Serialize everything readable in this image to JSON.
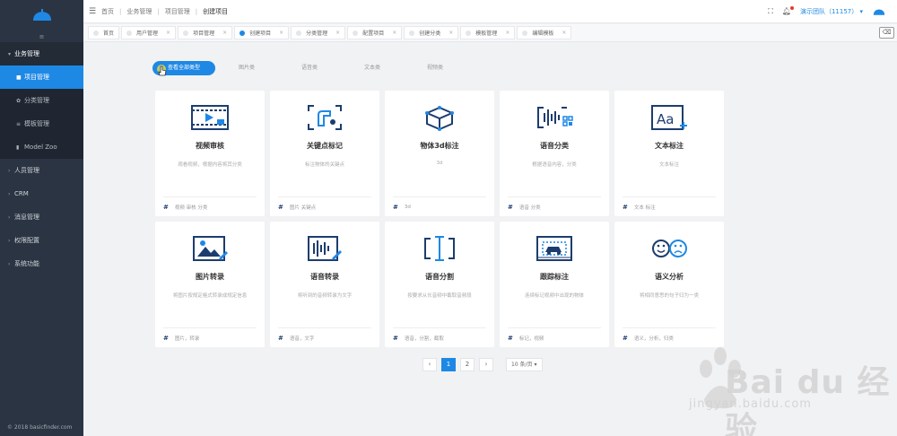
{
  "sidebar": {
    "collapse_icon": "≡",
    "groups": [
      {
        "label": "业务管理",
        "open": true
      },
      {
        "label": "人员管理"
      },
      {
        "label": "CRM"
      },
      {
        "label": "消息管理"
      },
      {
        "label": "权限配置"
      },
      {
        "label": "系统功能"
      }
    ],
    "sub_items": [
      {
        "label": "项目管理",
        "active": true
      },
      {
        "label": "分类管理"
      },
      {
        "label": "模板管理"
      },
      {
        "label": "Model Zoo"
      }
    ],
    "copyright": "© 2018 basicfinder.com"
  },
  "header": {
    "breadcrumbs": [
      "首页",
      "业务管理",
      "项目管理",
      "创建项目"
    ],
    "team": "演示团队（11157）"
  },
  "tabs": [
    {
      "label": "首页"
    },
    {
      "label": "用户管理"
    },
    {
      "label": "项目管理"
    },
    {
      "label": "创建项目",
      "active": true
    },
    {
      "label": "分类管理"
    },
    {
      "label": "配置项目"
    },
    {
      "label": "创建分类"
    },
    {
      "label": "模板管理"
    },
    {
      "label": "编辑模板"
    }
  ],
  "filters": [
    "查看全部类型",
    "图片类",
    "语音类",
    "文本类",
    "视频类"
  ],
  "cards": [
    {
      "title": "视频审核",
      "desc": "观看视频，根据内容将其分类",
      "tags": "视频 审核 分类",
      "icon": "video-review-icon"
    },
    {
      "title": "关键点标记",
      "desc": "标注物体的关键点",
      "tags": "图片 关键点",
      "icon": "keypoint-icon"
    },
    {
      "title": "物体3d标注",
      "desc": "3d",
      "tags": "3d",
      "icon": "cube-3d-icon"
    },
    {
      "title": "语音分类",
      "desc": "根据语音内容，分类",
      "tags": "语音 分类",
      "icon": "audio-classify-icon"
    },
    {
      "title": "文本标注",
      "desc": "文本标注",
      "tags": "文本 标注",
      "icon": "text-label-icon"
    },
    {
      "title": "图片转录",
      "desc": "将图片按规定格式转录成规定信息",
      "tags": "图片，转录",
      "icon": "image-transcribe-icon"
    },
    {
      "title": "语音转录",
      "desc": "将听到的音频转录为文字",
      "tags": "语音，文字",
      "icon": "audio-transcribe-icon"
    },
    {
      "title": "语音分割",
      "desc": "按要求从长音频中截取音频段",
      "tags": "语音，分割，截取",
      "icon": "audio-split-icon"
    },
    {
      "title": "跟踪标注",
      "desc": "连续标记视频中出现的物体",
      "tags": "标记，视频",
      "icon": "tracking-icon"
    },
    {
      "title": "语义分析",
      "desc": "将相同意思的句子归为一类",
      "tags": "语义，分析，归类",
      "icon": "semantic-icon"
    }
  ],
  "pagination": {
    "prev": "‹",
    "pages": [
      "1",
      "2"
    ],
    "next": "›",
    "page_size": "10 条/页"
  },
  "watermark": {
    "text": "Bai du 经验",
    "sub": "jingyan.baidu.com"
  },
  "colors": {
    "primary": "#1e88e5",
    "sidebar": "#2b3442",
    "icon": "#1c3d6e"
  }
}
